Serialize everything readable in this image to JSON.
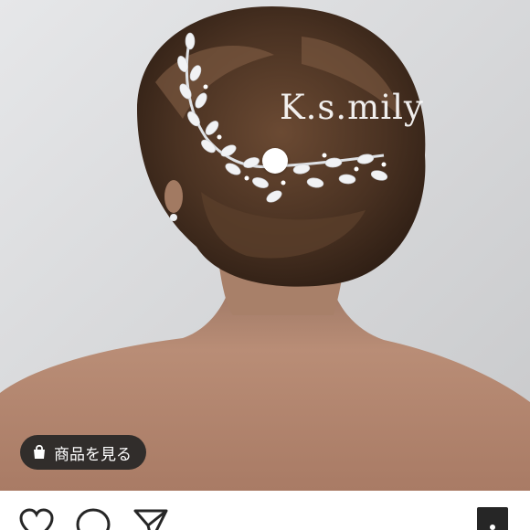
{
  "post": {
    "photo_description_icon": "photo-hair-accessory",
    "watermark": "K.s.mily",
    "shop_button": {
      "icon": "shopping-bag-icon",
      "label": "商品を見る"
    }
  },
  "actions": {
    "like_icon": "heart-icon",
    "comment_icon": "comment-icon",
    "share_icon": "paper-plane-icon",
    "save_icon": "bookmark-icon"
  },
  "colors": {
    "button_bg": "#262626",
    "button_text": "#ffffff",
    "icon_stroke": "#262626",
    "background": "#ffffff"
  }
}
